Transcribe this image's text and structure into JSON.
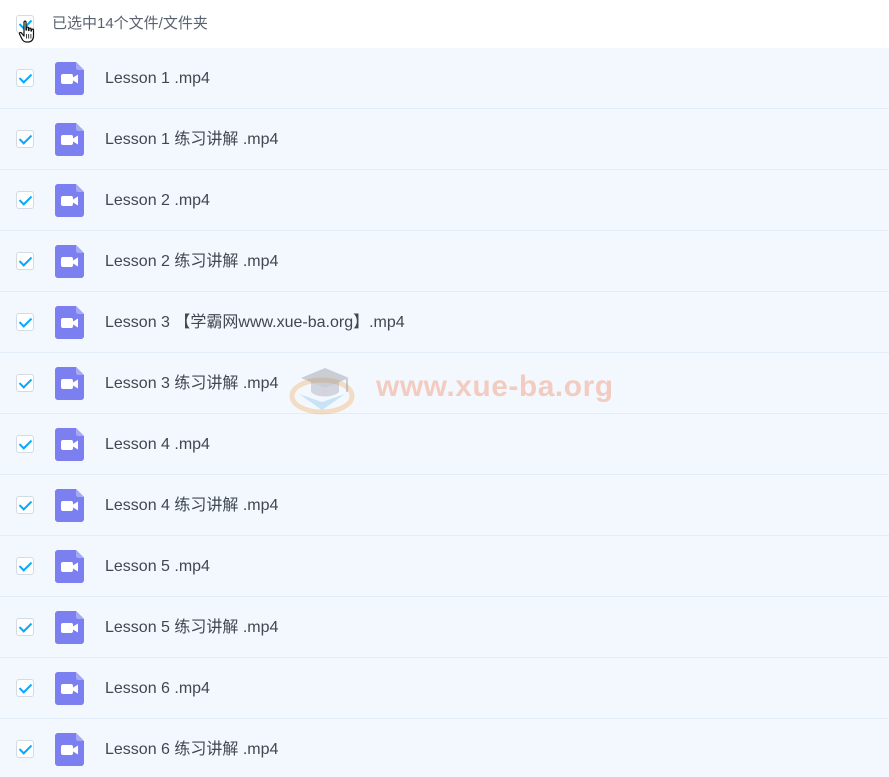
{
  "header": {
    "selection_label": "已选中14个文件/文件夹"
  },
  "colors": {
    "checkbox_accent": "#06a7ff",
    "video_icon": "#7b7ff0",
    "row_bg": "#f3f8fe"
  },
  "icons": {
    "file": "video-file-icon",
    "cursor": "hand-pointer-icon"
  },
  "files": [
    {
      "name": "Lesson 1 .mp4",
      "checked": true
    },
    {
      "name": "Lesson 1 练习讲解 .mp4",
      "checked": true
    },
    {
      "name": "Lesson 2 .mp4",
      "checked": true
    },
    {
      "name": "Lesson 2 练习讲解 .mp4",
      "checked": true
    },
    {
      "name": "Lesson 3 【学霸网www.xue-ba.org】.mp4",
      "checked": true
    },
    {
      "name": "Lesson 3 练习讲解 .mp4",
      "checked": true
    },
    {
      "name": "Lesson 4 .mp4",
      "checked": true
    },
    {
      "name": "Lesson 4 练习讲解 .mp4",
      "checked": true
    },
    {
      "name": "Lesson 5 .mp4",
      "checked": true
    },
    {
      "name": "Lesson 5 练习讲解 .mp4",
      "checked": true
    },
    {
      "name": "Lesson 6 .mp4",
      "checked": true
    },
    {
      "name": "Lesson 6 练习讲解 .mp4",
      "checked": true
    }
  ],
  "watermark": {
    "text": "www.xue-ba.org"
  }
}
